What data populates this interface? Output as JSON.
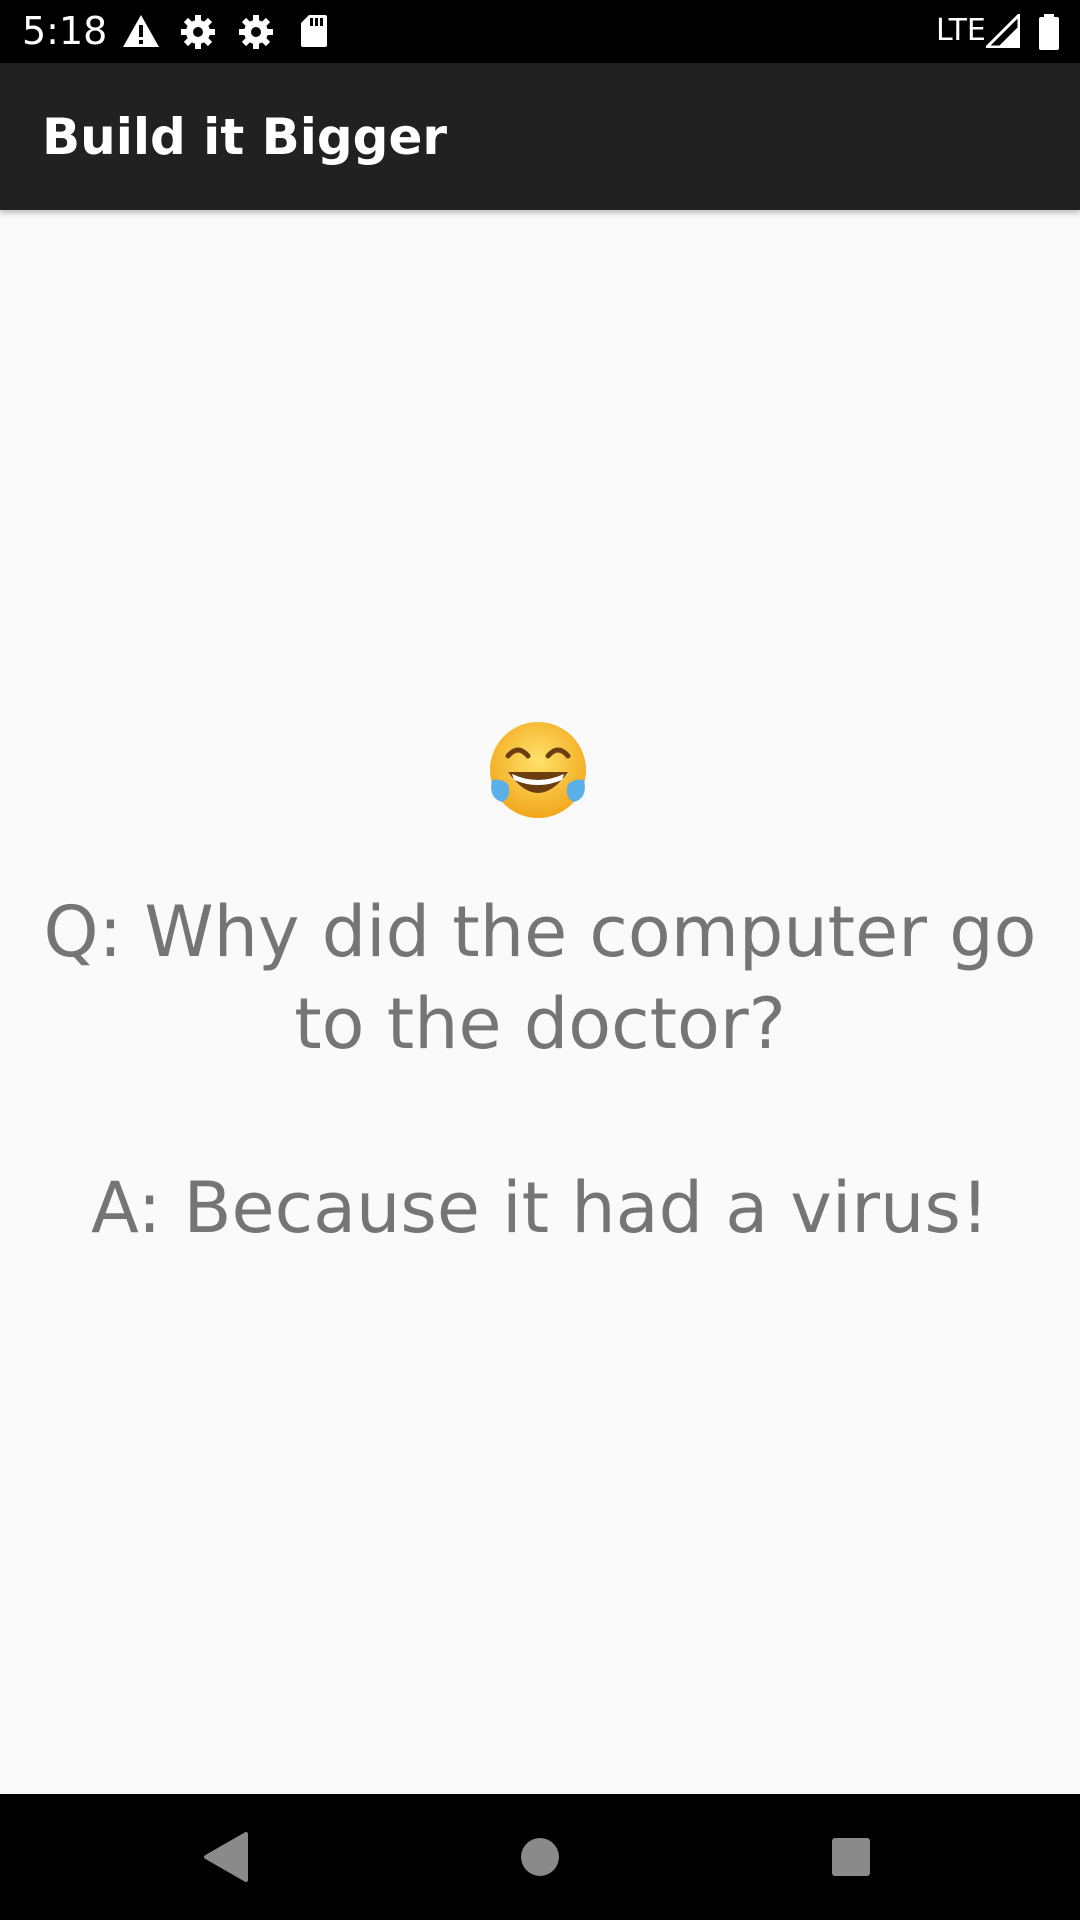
{
  "status_bar": {
    "time": "5:18",
    "network": "LTE",
    "icons": [
      "warning-icon",
      "settings-icon",
      "settings-icon",
      "sd-card-icon",
      "signal-icon",
      "battery-icon"
    ]
  },
  "app_bar": {
    "title": "Build it Bigger",
    "color": "#212121"
  },
  "joke": {
    "emoji": "face-with-tears-of-joy-icon",
    "text": "Q: Why did the computer go to the doctor?\n\nA: Because it had a virus!",
    "text_color": "#757575"
  },
  "nav_bar": {
    "buttons": [
      "back-icon",
      "home-icon",
      "recents-icon"
    ]
  }
}
